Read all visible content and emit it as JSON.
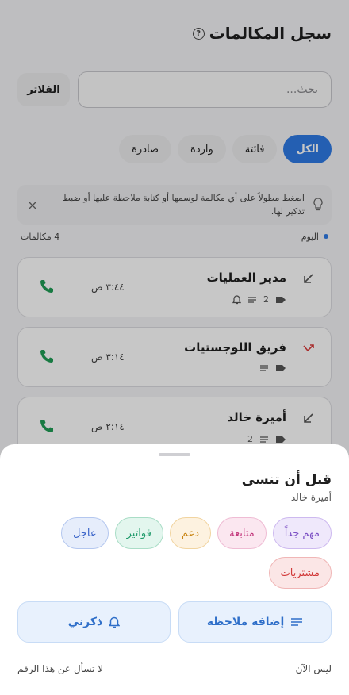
{
  "header": {
    "title": "سجل المكالمات",
    "help_glyph": "?"
  },
  "search": {
    "placeholder": "بحث...",
    "filters_label": "الفلاتر"
  },
  "tabs": [
    {
      "label": "الكل",
      "active": true
    },
    {
      "label": "فائتة",
      "active": false
    },
    {
      "label": "واردة",
      "active": false
    },
    {
      "label": "صادرة",
      "active": false
    }
  ],
  "tip": {
    "text": "اضغط مطولاً على أي مكالمة لوسمها أو كتابة ملاحظة عليها أو ضبط تذكير لها.",
    "close_glyph": "×"
  },
  "section": {
    "label": "اليوم",
    "count": "4 مكالمات"
  },
  "calls": [
    {
      "name": "مدير العمليات",
      "time": "٣:٤٤ ص",
      "tag_count": "2",
      "direction": "outgoing",
      "has_reminder": true
    },
    {
      "name": "فريق اللوجستيات",
      "time": "٣:١٤ ص",
      "tag_count": "",
      "direction": "missed",
      "has_reminder": false
    },
    {
      "name": "أميرة خالد",
      "time": "٢:١٤ ص",
      "tag_count": "2",
      "direction": "outgoing",
      "has_reminder": false
    }
  ],
  "sheet": {
    "title": "قبل أن تنسى",
    "subtitle": "أميرة خالد",
    "chips": [
      {
        "label": "مهم جداً",
        "color": "#7b4fc4",
        "bg": "#efe8fb",
        "border": "#cdb9ef"
      },
      {
        "label": "متابعة",
        "color": "#c2357a",
        "bg": "#fbe7f0",
        "border": "#efbcd4"
      },
      {
        "label": "دعم",
        "color": "#c98514",
        "bg": "#fdf2e0",
        "border": "#f1d4a0"
      },
      {
        "label": "فواتير",
        "color": "#1e9a6a",
        "bg": "#e3f6ee",
        "border": "#a9ddc6"
      },
      {
        "label": "عاجل",
        "color": "#3a64c9",
        "bg": "#e6edfb",
        "border": "#b4c7ef"
      },
      {
        "label": "مشتريات",
        "color": "#d23b3b",
        "bg": "#fbe6e6",
        "border": "#f0b6b6"
      }
    ],
    "add_note_label": "إضافة ملاحظة",
    "remind_label": "ذكرني",
    "not_now_label": "ليس الآن",
    "dont_ask_label": "لا تسأل عن هذا الرقم"
  },
  "colors": {
    "accent": "#2f7ae5",
    "call_green": "#1f9d55",
    "missed_red": "#d93c3c"
  }
}
